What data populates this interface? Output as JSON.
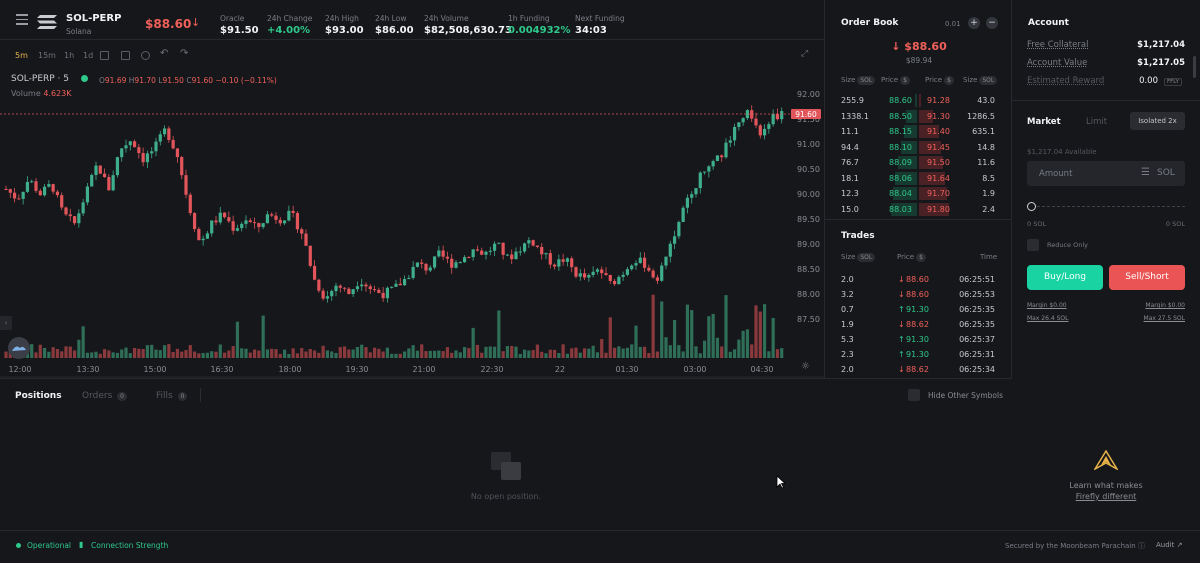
{
  "header": {
    "symbol": "SOL-PERP",
    "name": "Solana",
    "price": "$88.60",
    "stats": [
      {
        "label": "Oracle",
        "value": "$91.50",
        "tone": "white"
      },
      {
        "label": "24h Change",
        "value": "+4.00%",
        "tone": "green"
      },
      {
        "label": "24h High",
        "value": "$93.00",
        "tone": "white"
      },
      {
        "label": "24h Low",
        "value": "$86.00",
        "tone": "white"
      },
      {
        "label": "24h Volume",
        "value": "$82,508,630.73",
        "tone": "white"
      },
      {
        "label": "1h Funding",
        "value": "0.004932%",
        "tone": "green"
      },
      {
        "label": "Next Funding",
        "value": "34:03",
        "tone": "white"
      }
    ]
  },
  "chart_toolbar": {
    "timeframes": [
      "5m",
      "15m",
      "1h",
      "1d"
    ],
    "active": "5m"
  },
  "chart": {
    "legend_symbol": "SOL-PERP · 5",
    "ohlc": {
      "o_label": "O",
      "o": "91.69",
      "h_label": "H",
      "h": "91.70",
      "l_label": "L",
      "l": "91.50",
      "c_label": "C",
      "c": "91.60",
      "change": "−0.10 (−0.11%)"
    },
    "volume_label": "Volume",
    "volume_value": "4.623K",
    "last_price_tag": "91.60",
    "y_ticks": [
      "92.00",
      "91.50",
      "91.00",
      "90.50",
      "90.00",
      "89.50",
      "89.00",
      "88.50",
      "88.00",
      "87.50"
    ],
    "x_ticks": [
      "12:00",
      "13:30",
      "15:00",
      "16:30",
      "18:00",
      "19:30",
      "21:00",
      "22:30",
      "22",
      "01:30",
      "03:00",
      "04:30"
    ]
  },
  "chart_data": {
    "type": "candlestick",
    "y_range": [
      87.2,
      92.2
    ],
    "y_ticks": [
      92.0,
      91.5,
      91.0,
      90.5,
      90.0,
      89.5,
      89.0,
      88.5,
      88.0,
      87.5
    ],
    "x_ticks": [
      "12:00",
      "13:30",
      "15:00",
      "16:30",
      "18:00",
      "19:30",
      "21:00",
      "22:30",
      "22",
      "01:30",
      "03:00",
      "04:30"
    ],
    "close_path": [
      90.1,
      89.9,
      90.3,
      90.0,
      90.2,
      89.6,
      89.4,
      90.0,
      90.6,
      90.1,
      90.9,
      91.1,
      90.7,
      90.9,
      91.3,
      90.8,
      89.8,
      89.0,
      89.4,
      89.6,
      89.3,
      89.5,
      89.3,
      89.6,
      89.5,
      89.6,
      89.2,
      88.3,
      87.9,
      88.2,
      88.0,
      88.3,
      88.1,
      88.0,
      88.1,
      88.3,
      88.6,
      88.5,
      88.8,
      88.6,
      88.7,
      88.9,
      88.8,
      89.0,
      88.7,
      88.9,
      89.1,
      88.8,
      88.6,
      88.7,
      88.4,
      88.3,
      88.5,
      88.2,
      88.4,
      88.7,
      88.6,
      88.3,
      88.8,
      89.5,
      90.0,
      90.4,
      90.6,
      90.9,
      91.4,
      91.6,
      91.2,
      91.5,
      91.6
    ],
    "last_price": 91.6,
    "volume_last": "4.623K"
  },
  "orderbook": {
    "title": "Order Book",
    "tick": "0.01",
    "mid_price": "$88.60",
    "mark": "$89.94",
    "headers": [
      "Size",
      "Price",
      "Price",
      "Size"
    ],
    "units": [
      "SOL",
      "$",
      "$",
      "SOL"
    ],
    "rows": [
      {
        "bid_size": "255.9",
        "bid": "88.60",
        "ask": "91.28",
        "ask_size": "43.0",
        "bid_depth": 0.05,
        "ask_depth": 0.05
      },
      {
        "bid_size": "1338.1",
        "bid": "88.50",
        "ask": "91.30",
        "ask_size": "1286.5",
        "bid_depth": 0.35,
        "ask_depth": 0.35
      },
      {
        "bid_size": "11.1",
        "bid": "88.15",
        "ask": "91.40",
        "ask_size": "635.1",
        "bid_depth": 0.42,
        "ask_depth": 0.5
      },
      {
        "bid_size": "94.4",
        "bid": "88.10",
        "ask": "91.45",
        "ask_size": "14.8",
        "bid_depth": 0.5,
        "ask_depth": 0.55
      },
      {
        "bid_size": "76.7",
        "bid": "88.09",
        "ask": "91.50",
        "ask_size": "11.6",
        "bid_depth": 0.6,
        "ask_depth": 0.6
      },
      {
        "bid_size": "18.1",
        "bid": "88.06",
        "ask": "91.64",
        "ask_size": "8.5",
        "bid_depth": 0.68,
        "ask_depth": 0.65
      },
      {
        "bid_size": "12.3",
        "bid": "88.04",
        "ask": "91.70",
        "ask_size": "1.9",
        "bid_depth": 0.75,
        "ask_depth": 0.7
      },
      {
        "bid_size": "15.0",
        "bid": "88.03",
        "ask": "91.80",
        "ask_size": "2.4",
        "bid_depth": 0.82,
        "ask_depth": 0.75
      }
    ]
  },
  "trades": {
    "title": "Trades",
    "headers": [
      "Size",
      "Price",
      "Time"
    ],
    "units": [
      "SOL",
      "$"
    ],
    "rows": [
      {
        "size": "2.0",
        "price": "88.60",
        "time": "06:25:51",
        "side": "sell"
      },
      {
        "size": "3.2",
        "price": "88.60",
        "time": "06:25:53",
        "side": "sell"
      },
      {
        "size": "0.7",
        "price": "91.30",
        "time": "06:25:35",
        "side": "buy"
      },
      {
        "size": "1.9",
        "price": "88.62",
        "time": "06:25:35",
        "side": "sell"
      },
      {
        "size": "5.3",
        "price": "91.30",
        "time": "06:25:37",
        "side": "buy"
      },
      {
        "size": "2.3",
        "price": "91.30",
        "time": "06:25:31",
        "side": "buy"
      },
      {
        "size": "2.0",
        "price": "88.62",
        "time": "06:25:34",
        "side": "sell"
      }
    ]
  },
  "account": {
    "title": "Account",
    "free_collateral_label": "Free Collateral",
    "free_collateral": "$1,217.04",
    "account_value_label": "Account Value",
    "account_value": "$1,217.05",
    "est_reward_label": "Estimated Reward",
    "est_reward": "0.00",
    "est_reward_unit": "FFLY"
  },
  "order_form": {
    "tab_market": "Market",
    "tab_limit": "Limit",
    "margin_mode": "Isolated 2x",
    "available": "$1,217.04 Available",
    "amount_placeholder": "Amount",
    "amount_unit": "SOL",
    "slider_min": "0 SOL",
    "slider_max": "0 SOL",
    "reduce_only": "Reduce Only",
    "buy_label": "Buy/Long",
    "sell_label": "Sell/Short",
    "buy_margin": "Margin $0.00",
    "sell_margin": "Margin $0.00",
    "buy_max": "Max 26.4 SOL",
    "sell_max": "Max 27.5 SOL",
    "buy_color": "#19d3a2",
    "sell_color": "#ea5455"
  },
  "positions": {
    "tabs": [
      "Positions",
      "Orders",
      "Fills"
    ],
    "counts": [
      "",
      "0",
      "0"
    ],
    "hide_other": "Hide Other Symbols",
    "empty": "No open position."
  },
  "promo": {
    "line1": "Learn what makes",
    "line2": "Firefly different"
  },
  "footer": {
    "status": "Operational",
    "connection": "Connection Strength",
    "secured": "Secured by the Moonbeam Parachain",
    "audit": "Audit"
  }
}
